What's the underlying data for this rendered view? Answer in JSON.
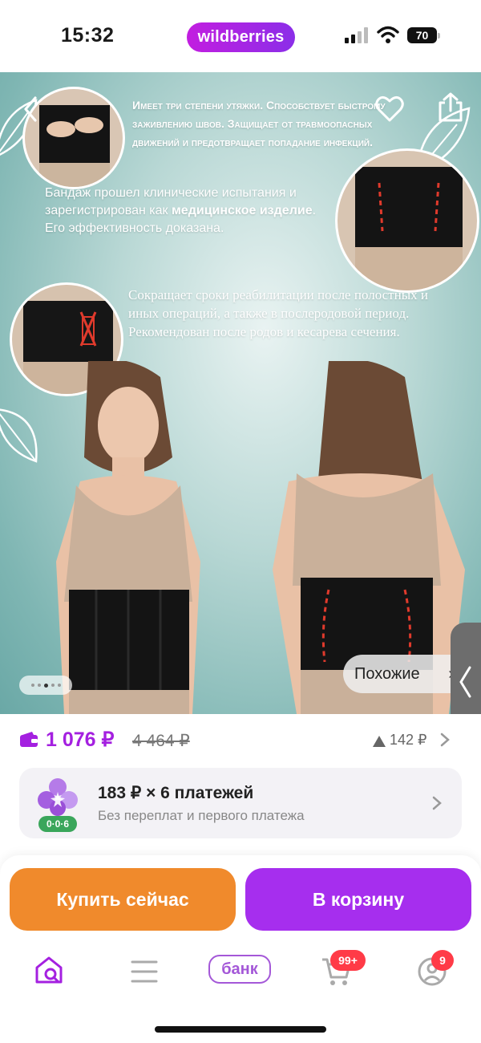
{
  "status_bar": {
    "time": "15:32",
    "brand": "wildberries",
    "battery": "70"
  },
  "product_image": {
    "promo_text_1": "Имеет три степени утяжки. Способствует быстрому заживлению швов. Защищает от травмоопасных движений и предотвращает попадание инфекций.",
    "promo_text_2_pre": "Бандаж прошел клинические испытания и зарегистрирован как ",
    "promo_text_2_bold": "медицинское изделие",
    "promo_text_2_post": ". Его эффективность доказана.",
    "promo_text_3": "Сокращает сроки реабилитации после полостных и иных операций, а также в послеродовой период. Рекомендован после родов и кесарева сечения.",
    "similar_label": "Похожие",
    "icons": [
      "back-icon",
      "heart-icon",
      "share-icon",
      "leaf-icon"
    ]
  },
  "price": {
    "current": "1 076 ₽",
    "old": "4 464 ₽",
    "delta": "142 ₽"
  },
  "installment": {
    "title": "183 ₽ × 6 платежей",
    "subtitle": "Без переплат и первого платежа",
    "badge": "0·0·6"
  },
  "actions": {
    "buy_now": "Купить сейчас",
    "add_to_cart": "В корзину"
  },
  "tabbar": {
    "bank_label": "банк",
    "cart_badge": "99+",
    "profile_badge": "9"
  },
  "colors": {
    "brand": "#a420e0",
    "buy": "#f08a2c",
    "cart": "#a62eee",
    "badge": "#ff3b47"
  }
}
